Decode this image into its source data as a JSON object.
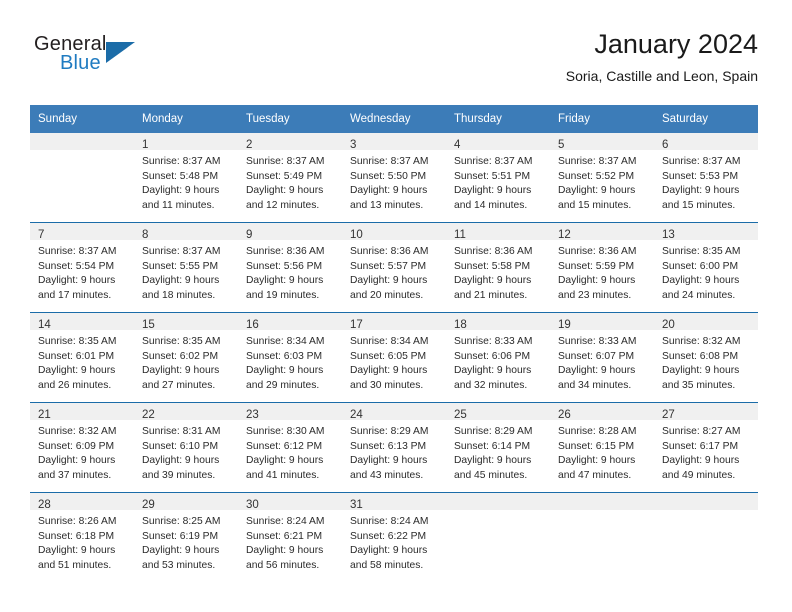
{
  "brand": {
    "name_top": "General",
    "name_bottom": "Blue",
    "color_dark": "#231f20",
    "color_blue": "#1f7bc1",
    "triangle_color": "#1b6ca8"
  },
  "header": {
    "title": "January 2024",
    "subtitle": "Soria, Castille and Leon, Spain"
  },
  "theme": {
    "header_row_bg": "#3c7cb8",
    "header_row_text": "#ffffff",
    "daynum_band_bg": "#f0f0f0",
    "row_divider": "#1b6ca8"
  },
  "weekdays": [
    "Sunday",
    "Monday",
    "Tuesday",
    "Wednesday",
    "Thursday",
    "Friday",
    "Saturday"
  ],
  "weeks": [
    [
      {
        "day": "",
        "lines": []
      },
      {
        "day": "1",
        "lines": [
          "Sunrise: 8:37 AM",
          "Sunset: 5:48 PM",
          "Daylight: 9 hours",
          "and 11 minutes."
        ]
      },
      {
        "day": "2",
        "lines": [
          "Sunrise: 8:37 AM",
          "Sunset: 5:49 PM",
          "Daylight: 9 hours",
          "and 12 minutes."
        ]
      },
      {
        "day": "3",
        "lines": [
          "Sunrise: 8:37 AM",
          "Sunset: 5:50 PM",
          "Daylight: 9 hours",
          "and 13 minutes."
        ]
      },
      {
        "day": "4",
        "lines": [
          "Sunrise: 8:37 AM",
          "Sunset: 5:51 PM",
          "Daylight: 9 hours",
          "and 14 minutes."
        ]
      },
      {
        "day": "5",
        "lines": [
          "Sunrise: 8:37 AM",
          "Sunset: 5:52 PM",
          "Daylight: 9 hours",
          "and 15 minutes."
        ]
      },
      {
        "day": "6",
        "lines": [
          "Sunrise: 8:37 AM",
          "Sunset: 5:53 PM",
          "Daylight: 9 hours",
          "and 15 minutes."
        ]
      }
    ],
    [
      {
        "day": "7",
        "lines": [
          "Sunrise: 8:37 AM",
          "Sunset: 5:54 PM",
          "Daylight: 9 hours",
          "and 17 minutes."
        ]
      },
      {
        "day": "8",
        "lines": [
          "Sunrise: 8:37 AM",
          "Sunset: 5:55 PM",
          "Daylight: 9 hours",
          "and 18 minutes."
        ]
      },
      {
        "day": "9",
        "lines": [
          "Sunrise: 8:36 AM",
          "Sunset: 5:56 PM",
          "Daylight: 9 hours",
          "and 19 minutes."
        ]
      },
      {
        "day": "10",
        "lines": [
          "Sunrise: 8:36 AM",
          "Sunset: 5:57 PM",
          "Daylight: 9 hours",
          "and 20 minutes."
        ]
      },
      {
        "day": "11",
        "lines": [
          "Sunrise: 8:36 AM",
          "Sunset: 5:58 PM",
          "Daylight: 9 hours",
          "and 21 minutes."
        ]
      },
      {
        "day": "12",
        "lines": [
          "Sunrise: 8:36 AM",
          "Sunset: 5:59 PM",
          "Daylight: 9 hours",
          "and 23 minutes."
        ]
      },
      {
        "day": "13",
        "lines": [
          "Sunrise: 8:35 AM",
          "Sunset: 6:00 PM",
          "Daylight: 9 hours",
          "and 24 minutes."
        ]
      }
    ],
    [
      {
        "day": "14",
        "lines": [
          "Sunrise: 8:35 AM",
          "Sunset: 6:01 PM",
          "Daylight: 9 hours",
          "and 26 minutes."
        ]
      },
      {
        "day": "15",
        "lines": [
          "Sunrise: 8:35 AM",
          "Sunset: 6:02 PM",
          "Daylight: 9 hours",
          "and 27 minutes."
        ]
      },
      {
        "day": "16",
        "lines": [
          "Sunrise: 8:34 AM",
          "Sunset: 6:03 PM",
          "Daylight: 9 hours",
          "and 29 minutes."
        ]
      },
      {
        "day": "17",
        "lines": [
          "Sunrise: 8:34 AM",
          "Sunset: 6:05 PM",
          "Daylight: 9 hours",
          "and 30 minutes."
        ]
      },
      {
        "day": "18",
        "lines": [
          "Sunrise: 8:33 AM",
          "Sunset: 6:06 PM",
          "Daylight: 9 hours",
          "and 32 minutes."
        ]
      },
      {
        "day": "19",
        "lines": [
          "Sunrise: 8:33 AM",
          "Sunset: 6:07 PM",
          "Daylight: 9 hours",
          "and 34 minutes."
        ]
      },
      {
        "day": "20",
        "lines": [
          "Sunrise: 8:32 AM",
          "Sunset: 6:08 PM",
          "Daylight: 9 hours",
          "and 35 minutes."
        ]
      }
    ],
    [
      {
        "day": "21",
        "lines": [
          "Sunrise: 8:32 AM",
          "Sunset: 6:09 PM",
          "Daylight: 9 hours",
          "and 37 minutes."
        ]
      },
      {
        "day": "22",
        "lines": [
          "Sunrise: 8:31 AM",
          "Sunset: 6:10 PM",
          "Daylight: 9 hours",
          "and 39 minutes."
        ]
      },
      {
        "day": "23",
        "lines": [
          "Sunrise: 8:30 AM",
          "Sunset: 6:12 PM",
          "Daylight: 9 hours",
          "and 41 minutes."
        ]
      },
      {
        "day": "24",
        "lines": [
          "Sunrise: 8:29 AM",
          "Sunset: 6:13 PM",
          "Daylight: 9 hours",
          "and 43 minutes."
        ]
      },
      {
        "day": "25",
        "lines": [
          "Sunrise: 8:29 AM",
          "Sunset: 6:14 PM",
          "Daylight: 9 hours",
          "and 45 minutes."
        ]
      },
      {
        "day": "26",
        "lines": [
          "Sunrise: 8:28 AM",
          "Sunset: 6:15 PM",
          "Daylight: 9 hours",
          "and 47 minutes."
        ]
      },
      {
        "day": "27",
        "lines": [
          "Sunrise: 8:27 AM",
          "Sunset: 6:17 PM",
          "Daylight: 9 hours",
          "and 49 minutes."
        ]
      }
    ],
    [
      {
        "day": "28",
        "lines": [
          "Sunrise: 8:26 AM",
          "Sunset: 6:18 PM",
          "Daylight: 9 hours",
          "and 51 minutes."
        ]
      },
      {
        "day": "29",
        "lines": [
          "Sunrise: 8:25 AM",
          "Sunset: 6:19 PM",
          "Daylight: 9 hours",
          "and 53 minutes."
        ]
      },
      {
        "day": "30",
        "lines": [
          "Sunrise: 8:24 AM",
          "Sunset: 6:21 PM",
          "Daylight: 9 hours",
          "and 56 minutes."
        ]
      },
      {
        "day": "31",
        "lines": [
          "Sunrise: 8:24 AM",
          "Sunset: 6:22 PM",
          "Daylight: 9 hours",
          "and 58 minutes."
        ]
      },
      {
        "day": "",
        "lines": []
      },
      {
        "day": "",
        "lines": []
      },
      {
        "day": "",
        "lines": []
      }
    ]
  ]
}
